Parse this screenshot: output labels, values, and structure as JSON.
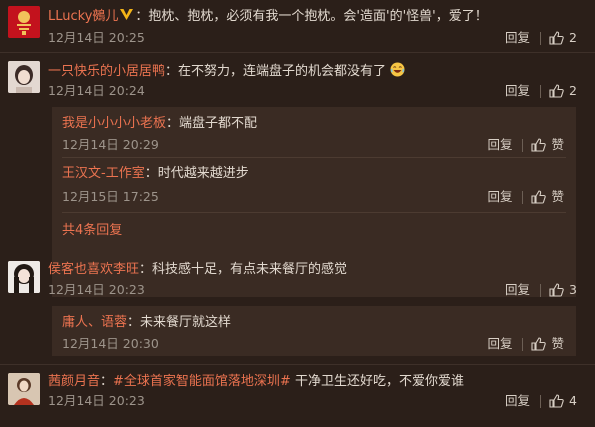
{
  "comments": [
    {
      "username": "LLucky鵺儿",
      "verified_badge": "vip-v-icon",
      "text": "抱枕、抱枕，必须有我一个抱枕。会'造面'的'怪兽'，爱了！",
      "timestamp": "12月14日 20:25",
      "reply_label": "回复",
      "likes": "2"
    },
    {
      "username": "一只快乐的小居居鸭",
      "text": "在不努力，连端盘子的机会都没有了",
      "emoji": "laughing-face-emoji",
      "timestamp": "12月14日 20:24",
      "reply_label": "回复",
      "likes": "2",
      "replies": [
        {
          "username": "我是小小小小老板",
          "text": "端盘子都不配",
          "timestamp": "12月14日 20:29",
          "reply_label": "回复",
          "likes": "赞"
        },
        {
          "username": "王汉文-工作室",
          "text": "时代越来越进步",
          "timestamp": "12月15日 17:25",
          "reply_label": "回复",
          "likes": "赞"
        }
      ],
      "more_replies": "共4条回复"
    },
    {
      "username": "侯客也喜欢李旺",
      "text": "科技感十足，有点未来餐厅的感觉",
      "timestamp": "12月14日 20:23",
      "reply_label": "回复",
      "likes": "3",
      "replies": [
        {
          "username": "庸人、语蓉",
          "text": "未来餐厅就这样",
          "timestamp": "12月14日 20:30",
          "reply_label": "回复",
          "likes": "赞"
        }
      ]
    },
    {
      "username": "茜颜月音",
      "hashtag": "#全球首家智能面馆落地深圳#",
      "text": " 干净卫生还好吃，不爱你爱谁",
      "timestamp": "12月14日 20:23",
      "reply_label": "回复",
      "likes": "4"
    }
  ]
}
